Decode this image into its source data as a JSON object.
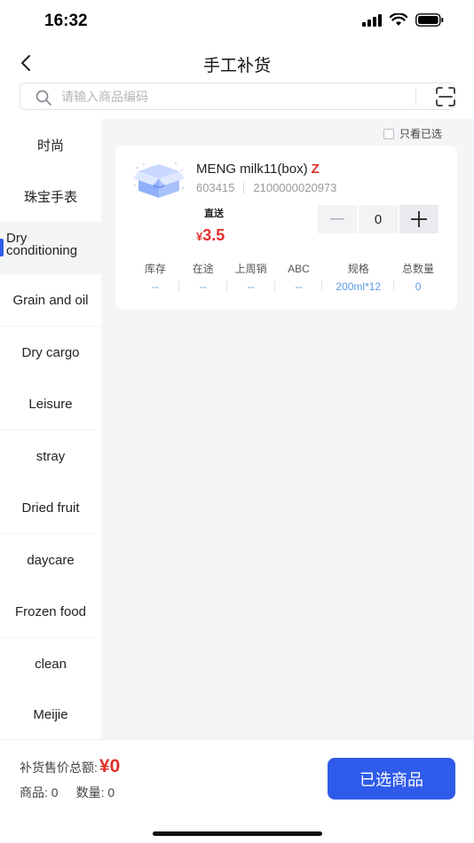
{
  "status_bar": {
    "time": "16:32"
  },
  "header": {
    "title": "手工补货"
  },
  "search": {
    "placeholder": "请输入商品编码"
  },
  "sidebar": {
    "items": [
      {
        "label": "时尚"
      },
      {
        "label": "珠宝手表"
      },
      {
        "label": "Dry conditioning",
        "active": true
      },
      {
        "label": "Grain and oil"
      },
      {
        "label": "Dry cargo"
      },
      {
        "label": "Leisure"
      },
      {
        "label": "stray"
      },
      {
        "label": "Dried fruit"
      },
      {
        "label": "daycare"
      },
      {
        "label": "Frozen food"
      },
      {
        "label": "clean"
      },
      {
        "label": "Meijie"
      }
    ]
  },
  "filter": {
    "only_selected_label": "只看已选"
  },
  "product": {
    "name": "MENG milk11(box)",
    "tag": "Z",
    "code": "603415",
    "barcode": "2100000020973",
    "ship_tag": "直送",
    "currency": "¥",
    "price": "3.5",
    "quantity": "0",
    "stats": [
      {
        "label": "库存",
        "value": "--"
      },
      {
        "label": "在途",
        "value": "--"
      },
      {
        "label": "上周销",
        "value": "--"
      },
      {
        "label": "ABC",
        "value": "--"
      },
      {
        "label": "规格",
        "value": "200ml*12"
      },
      {
        "label": "总数量",
        "value": "0"
      }
    ]
  },
  "footer": {
    "total_label": "补货售价总额:",
    "total_amount": "¥0",
    "goods_label": "商品:",
    "goods_count": "0",
    "qty_label": "数量:",
    "qty_count": "0",
    "confirm_label": "已选商品"
  },
  "colors": {
    "accent": "#2f5bea",
    "price": "#e0302b",
    "stat_value": "#5b9be8"
  }
}
